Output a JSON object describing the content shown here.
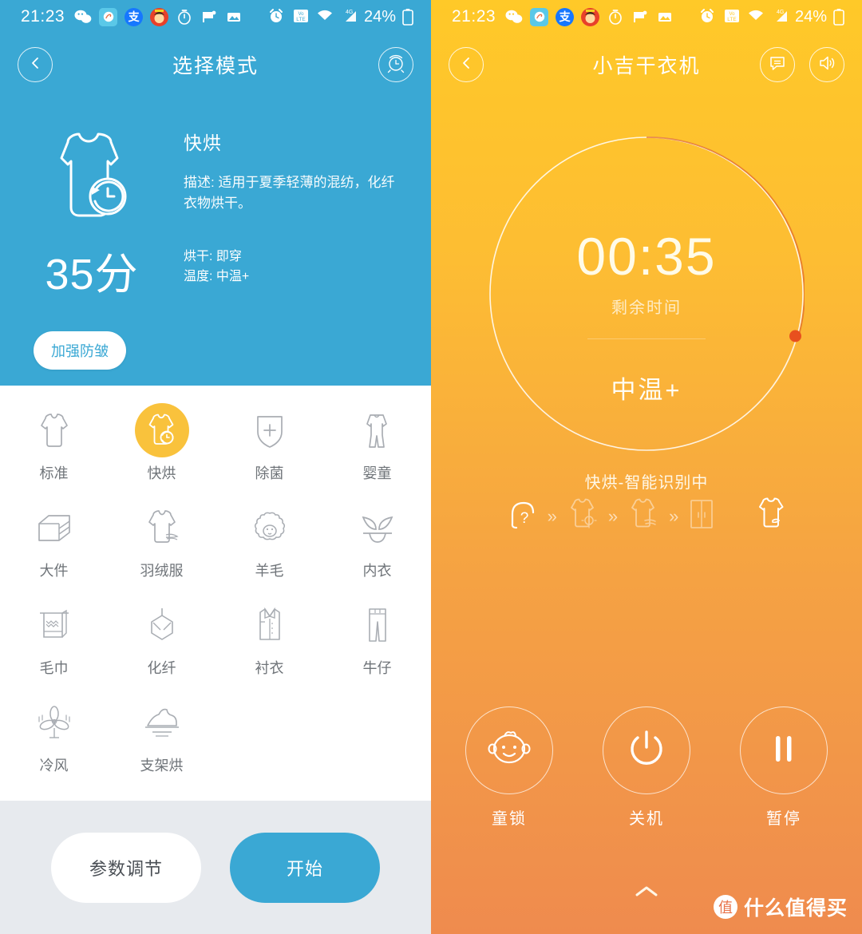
{
  "status_bar": {
    "time": "21:23",
    "battery_pct": "24%",
    "network": "4G",
    "volte": "VoLTE",
    "left_icons": [
      "wechat-icon",
      "weibo-icon",
      "alipay-icon",
      "avatar-icon",
      "stopwatch-icon",
      "flag-icon",
      "gallery-icon"
    ],
    "right_icons": [
      "alarm-icon",
      "volte-icon",
      "wifi-icon",
      "signal-icon",
      "battery-icon"
    ]
  },
  "left_panel": {
    "nav": {
      "back_icon": "chevron-left-icon",
      "title": "选择模式",
      "right_icon": "alarm-timer-icon"
    },
    "hero": {
      "duration": "35分",
      "mode_name": "快烘",
      "description": "描述: 适用于夏季轻薄的混纺，化纤衣物烘干。",
      "dry_level": "烘干: 即穿",
      "temperature": "温度: 中温+",
      "reinforce_label": "加强防皱",
      "bg_color": "#3aa8d4"
    },
    "modes": [
      {
        "label": "标准",
        "icon": "tshirt-icon",
        "selected": false
      },
      {
        "label": "快烘",
        "icon": "tshirt-clock-icon",
        "selected": true
      },
      {
        "label": "除菌",
        "icon": "shield-plus-icon",
        "selected": false
      },
      {
        "label": "婴童",
        "icon": "baby-romper-icon",
        "selected": false
      },
      {
        "label": "大件",
        "icon": "folded-linen-icon",
        "selected": false
      },
      {
        "label": "羽绒服",
        "icon": "down-jacket-icon",
        "selected": false
      },
      {
        "label": "羊毛",
        "icon": "sheep-icon",
        "selected": false
      },
      {
        "label": "内衣",
        "icon": "underwear-icon",
        "selected": false
      },
      {
        "label": "毛巾",
        "icon": "towel-icon",
        "selected": false
      },
      {
        "label": "化纤",
        "icon": "synthetic-fiber-icon",
        "selected": false
      },
      {
        "label": "衬衣",
        "icon": "shirt-icon",
        "selected": false
      },
      {
        "label": "牛仔",
        "icon": "jeans-icon",
        "selected": false
      },
      {
        "label": "冷风",
        "icon": "fan-icon",
        "selected": false
      },
      {
        "label": "支架烘",
        "icon": "rack-shoe-icon",
        "selected": false
      }
    ],
    "actions": {
      "param_label": "参数调节",
      "start_label": "开始",
      "start_color": "#3aa8d4"
    }
  },
  "right_panel": {
    "nav": {
      "back_icon": "chevron-left-icon",
      "title": "小吉干衣机",
      "icons": [
        "message-icon",
        "speaker-icon"
      ]
    },
    "dial": {
      "time": "00:35",
      "sub_label": "剩余时间",
      "temperature": "中温+",
      "progress_pct": 73,
      "dot_color": "#e8501e",
      "ring_color": "#ffffff"
    },
    "status_text": "快烘-智能识别中",
    "flow_steps": [
      "sensor-question-icon",
      "tshirt-heat-icon",
      "tshirt-air-icon",
      "wardrobe-icon",
      "tshirt-done-icon"
    ],
    "flow_separator": "»",
    "controls": [
      {
        "label": "童锁",
        "icon": "baby-face-icon"
      },
      {
        "label": "关机",
        "icon": "power-icon"
      },
      {
        "label": "暂停",
        "icon": "pause-icon"
      }
    ],
    "expand_icon": "chevron-up-icon",
    "watermark": {
      "badge": "值",
      "text": "什么值得买"
    },
    "gradient_top": "#ffc928",
    "gradient_bottom": "#ef8b4e"
  }
}
